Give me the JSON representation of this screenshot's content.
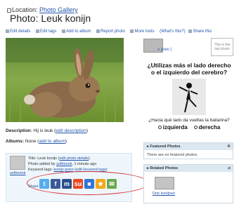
{
  "header": {
    "location_label": "Location:",
    "location_link": "Photo Gallery",
    "title": "Photo: Leuk konijn"
  },
  "toolbar": {
    "items": [
      "Edit details",
      "Edit tags",
      "Add to album",
      "Report photo",
      "More tools",
      "(What's this?)",
      "Share this"
    ]
  },
  "description": {
    "label": "Description",
    "text": ": Hij is leuk (",
    "link": "edit description",
    "close": ")"
  },
  "albums": {
    "label": "Albums:",
    "text": " None (",
    "link": "add to album",
    "close": ")"
  },
  "info": {
    "title_label": "Title: Leuk konijn (",
    "title_link": "edit photo details",
    "added_label": "Photo added by ",
    "added_user": "softmonk",
    "added_time": ", 1 minute ago",
    "tags_label": "Keyword tags: ",
    "tags_link1": "konijn",
    "tags_link2": "prein",
    "tags_edit": "edit keyword tags",
    "user_below": "softmonk",
    "share_link": "Share this"
  },
  "share_icons": [
    {
      "name": "twitter-icon",
      "glyph": "t",
      "color": "#55acee"
    },
    {
      "name": "facebook-icon",
      "glyph": "f",
      "color": "#3b5998"
    },
    {
      "name": "myspace-icon",
      "glyph": "m",
      "color": "#2a4f8a"
    },
    {
      "name": "stumbleupon-icon",
      "glyph": "su",
      "color": "#eb4823"
    },
    {
      "name": "delicious-icon",
      "glyph": "■",
      "color": "#3274d2"
    },
    {
      "name": "favorites-icon",
      "glyph": "★",
      "color": "#f2a81d"
    },
    {
      "name": "email-icon",
      "glyph": "✉",
      "color": "#6aa84f"
    }
  ],
  "nav": {
    "prev": "« prev |",
    "last": "This is the last photo"
  },
  "ad": {
    "question": "¿Utilizas más el lado derecho o el izquierdo del cerebro?",
    "question2": "¿Hacia qué lado da vueltas la bailarina?",
    "opt_left": "izquierda",
    "opt_right": "derecha"
  },
  "featured": {
    "header": "Featured Photos",
    "body": "There are no featured photos."
  },
  "related": {
    "header": "Related Photos",
    "thumb_label": "Drie konijnen"
  },
  "colors": {
    "link": "#2255aa",
    "highlight_ellipse": "#d9333a",
    "panel_header": "#dbe8f2"
  }
}
